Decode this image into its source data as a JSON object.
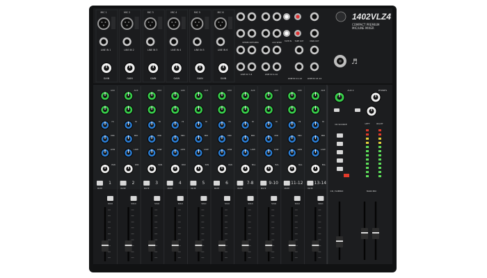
{
  "brand": {
    "model": "1402VLZ4",
    "subtitle_lines": [
      "COMPACT PREMIUM",
      "MIC/LINE MIXER"
    ],
    "logo": "mackie-running-man-logo"
  },
  "top_row": {
    "mic_labels": [
      "MIC 1",
      "MIC 2",
      "MIC 3",
      "MIC 4",
      "MIC 5",
      "MIC 6"
    ],
    "line_labels": [
      "LINE IN 1",
      "LINE IN 2",
      "LINE IN 3",
      "LINE IN 4",
      "LINE IN 5",
      "LINE IN 6"
    ],
    "gain_label": "GAIN",
    "stereo_line_labels": [
      "LINE IN 7-8",
      "LINE IN 9-10",
      "LINE IN 11-12",
      "LINE IN 13-14"
    ],
    "section_labels": [
      "STEREO RETURNS",
      "AUX SEND",
      "TAPE IN",
      "TAPE OUT",
      "MAIN OUT"
    ]
  },
  "channel_strip": {
    "aux_label": "AUX",
    "eq_labels": [
      "HI",
      "MID",
      "LOW"
    ],
    "pan_label": "PAN",
    "bal_label": "BAL",
    "mute_label": "MUTE",
    "solo_label": "SOLO"
  },
  "channels": [
    "1",
    "2",
    "3",
    "4",
    "5",
    "6",
    "7-8",
    "9-10",
    "11-12",
    "13-14"
  ],
  "master": {
    "aux_return_label": "AUX 2",
    "phones_label": "PHONES",
    "cr_source_label": "CR SOURCE",
    "meter_labels": [
      "LEFT",
      "RIGHT"
    ],
    "main_mix_label": "MAIN MIX",
    "cr_phones_label": "CR / SUBMIX"
  },
  "colors": {
    "panel": "#1c1d1f",
    "panel_edge": "#0c0c0d",
    "strip_divider": "#2e3033",
    "aux_knob": "#37d04a",
    "eq_knob": "#2a7fd8",
    "gain_knob": "#f0f0f0",
    "pan_knob": "#f0f0f0",
    "fader_cap": "#dadada",
    "meter_green": "#5ee15a",
    "meter_yellow": "#e6d23a",
    "meter_red": "#e23a2a"
  }
}
